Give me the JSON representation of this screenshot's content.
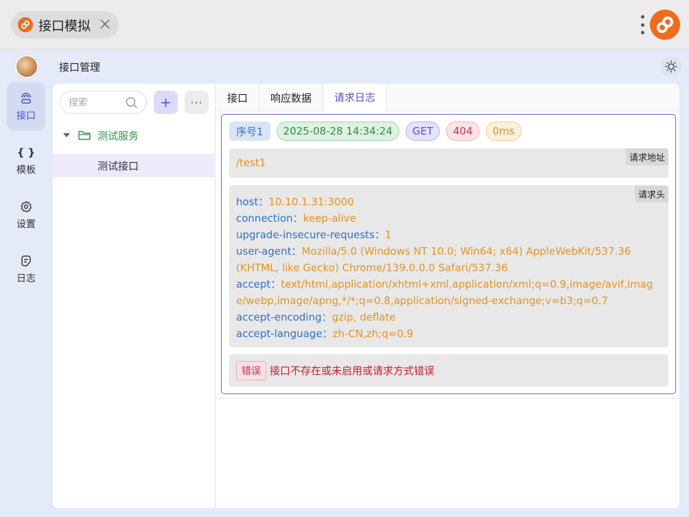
{
  "window": {
    "tab_title": "接口模拟",
    "app_title": "接口管理"
  },
  "nav": [
    {
      "label": "接口",
      "icon": "broadcast-icon",
      "active": true
    },
    {
      "label": "模板",
      "icon": "braces-icon",
      "active": false
    },
    {
      "label": "设置",
      "icon": "gear-icon",
      "active": false
    },
    {
      "label": "日志",
      "icon": "log-icon",
      "active": false
    }
  ],
  "sidebar": {
    "search_placeholder": "搜索",
    "add_label": "+",
    "more_label": "···",
    "group": "测试服务",
    "item": "测试接口"
  },
  "tabs": [
    {
      "label": "接口",
      "active": false
    },
    {
      "label": "响应数据",
      "active": false
    },
    {
      "label": "请求日志",
      "active": true
    }
  ],
  "log": {
    "seq": "序号1",
    "time": "2025-08-28 14:34:24",
    "method": "GET",
    "status": "404",
    "duration": "0ms",
    "url_label": "请求地址",
    "url": "/test1",
    "headers_label": "请求头",
    "headers": [
      {
        "key": "host：",
        "value": "10.10.1.31:3000"
      },
      {
        "key": "connection：",
        "value": "keep-alive"
      },
      {
        "key": "upgrade-insecure-requests：",
        "value": "1"
      },
      {
        "key": "user-agent：",
        "value": "Mozilla/5.0 (Windows NT 10.0; Win64; x64) AppleWebKit/537.36 (KHTML, like Gecko) Chrome/139.0.0.0 Safari/537.36"
      },
      {
        "key": "accept：",
        "value": "text/html,application/xhtml+xml,application/xml;q=0.9,image/avif,image/webp,image/apng,*/*;q=0.8,application/signed-exchange;v=b3;q=0.7"
      },
      {
        "key": "accept-encoding：",
        "value": "gzip, deflate"
      },
      {
        "key": "accept-language：",
        "value": "zh-CN,zh;q=0.9"
      }
    ],
    "error_tag": "错误",
    "error_msg": "接口不存在或未启用或请求方式错误"
  },
  "colors": {
    "accent": "#5b50d8",
    "brand": "#f26b1d",
    "key": "#2f6fd0",
    "value": "#e59420",
    "error": "#d0182c"
  }
}
